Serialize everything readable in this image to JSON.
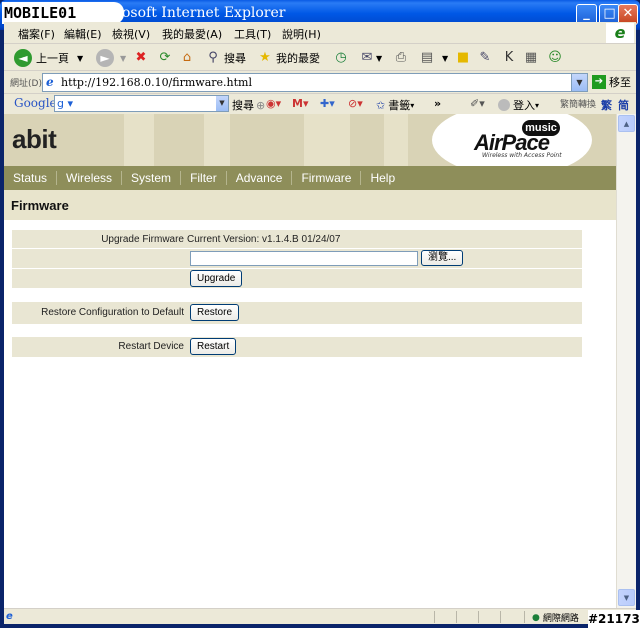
{
  "window": {
    "watermark": "MOBILE01",
    "title": "osoft Internet Explorer",
    "minimize_glyph": "_",
    "maximize_glyph": "□",
    "close_glyph": "✕",
    "watermark_id": "#21173"
  },
  "menubar": {
    "items": [
      "檔案(F)",
      "編輯(E)",
      "檢視(V)",
      "我的最愛(A)",
      "工具(T)",
      "說明(H)"
    ]
  },
  "toolbar": {
    "back_label": "上一頁",
    "search_label": "搜尋",
    "favorites_label": "我的最愛"
  },
  "address": {
    "label": "網址(D)",
    "url": "http://192.168.0.10/firmware.html",
    "go_label": "移至"
  },
  "googlebar": {
    "logo": "Google",
    "input_value": "g ▾",
    "search_label": "搜尋",
    "bookmarks_label": "書籤",
    "more_glyph": "»",
    "login_label": "登入",
    "convert_label": "繁簡轉換",
    "trad_label": "繁",
    "simp_label": "简"
  },
  "brand": {
    "logo": "abit",
    "product_badge": "music",
    "product_name": "AirPace",
    "product_tagline": "Wireless with Access Point"
  },
  "nav": {
    "items": [
      "Status",
      "Wireless",
      "System",
      "Filter",
      "Advance",
      "Firmware",
      "Help"
    ]
  },
  "page": {
    "title": "Firmware",
    "upgrade_label": "Upgrade Firmware",
    "current_version": "Current Version: v1.1.4.B 01/24/07",
    "browse_button": "瀏覽...",
    "upgrade_button": "Upgrade",
    "restore_label": "Restore Configuration to Default",
    "restore_button": "Restore",
    "restart_label": "Restart Device",
    "restart_button": "Restart"
  },
  "statusbar": {
    "zone_label": "網際網路"
  }
}
